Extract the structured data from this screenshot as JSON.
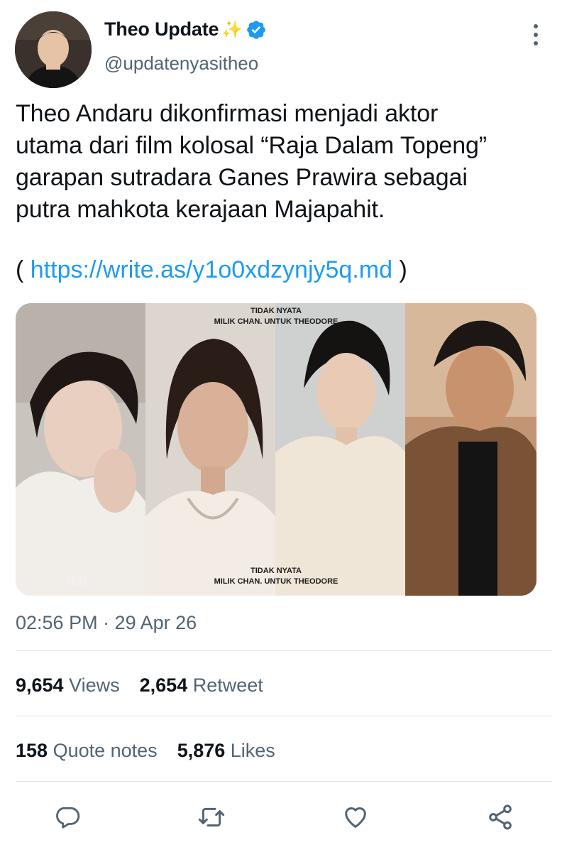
{
  "tweet": {
    "display_name": "Theo Update",
    "name_emoji": "✨",
    "handle": "@updatenyasitheo",
    "text_lines": [
      "Theo Andaru dikonfirmasi menjadi aktor",
      "utama dari film kolosal “Raja Dalam Topeng”",
      "garapan sutradara Ganes Prawira sebagai",
      "putra mahkota kerajaan Majapahit."
    ],
    "link_open": "( ",
    "link_text": "https://write.as/y1o0xdzynjy5q.md",
    "link_close": " )",
    "media": {
      "watermark_top_1": "TIDAK NYATA",
      "watermark_top_2": "MILIK CHAN. UNTUK THEODORE",
      "watermark_bottom_1": "TIDAK NYATA",
      "watermark_bottom_2": "MILIK CHAN. UNTUK THEODORE",
      "photo_caption": "格调"
    },
    "timestamp": "02:56 PM · 29 Apr 26",
    "stats": {
      "views_count": "9,654",
      "views_label": "Views",
      "retweet_count": "2,654",
      "retweet_label": "Retweet",
      "quote_count": "158",
      "quote_label": "Quote notes",
      "likes_count": "5,876",
      "likes_label": "Likes"
    },
    "icons": [
      "reply-icon",
      "retweet-icon",
      "like-icon",
      "share-icon",
      "more-icon",
      "verified-icon"
    ],
    "colors": {
      "accent": "#1d9bf0",
      "secondary_text": "#536471",
      "divider": "#e1e6ea"
    }
  }
}
